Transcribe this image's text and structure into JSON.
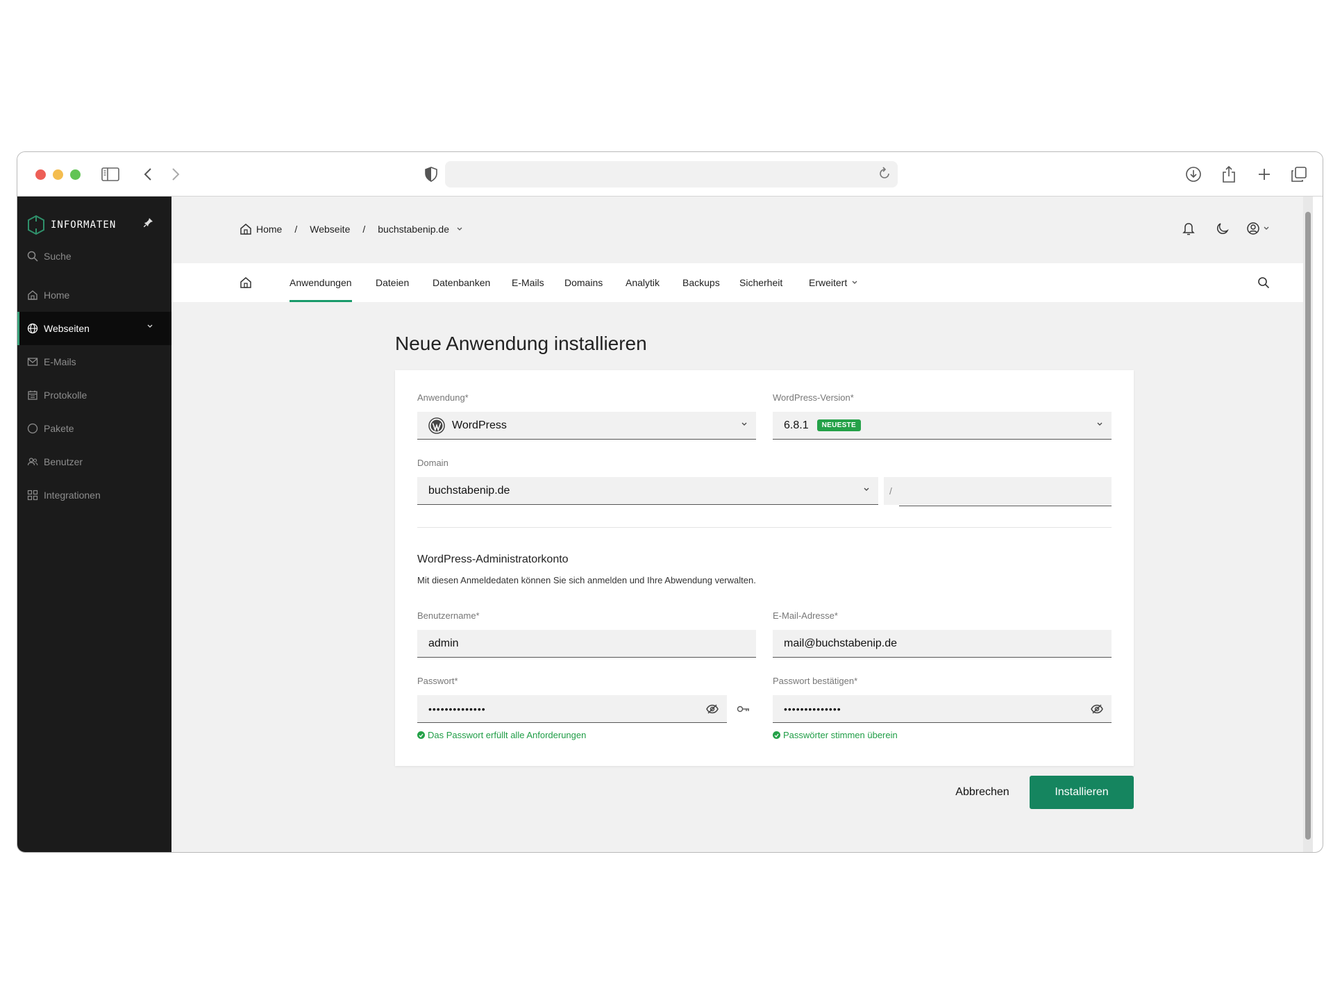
{
  "sidebar": {
    "brand": "INFORMATEN",
    "search_label": "Suche",
    "items": [
      {
        "label": "Home",
        "icon": "home-icon"
      },
      {
        "label": "Webseiten",
        "icon": "globe-icon",
        "active": true
      },
      {
        "label": "E-Mails",
        "icon": "mail-icon"
      },
      {
        "label": "Protokolle",
        "icon": "calendar-icon"
      },
      {
        "label": "Pakete",
        "icon": "circle-icon"
      },
      {
        "label": "Benutzer",
        "icon": "users-icon"
      },
      {
        "label": "Integrationen",
        "icon": "grid-icon"
      }
    ]
  },
  "breadcrumb": {
    "home": "Home",
    "sep": "/",
    "section": "Webseite",
    "site": "buchstabenip.de"
  },
  "tabs": [
    "Anwendungen",
    "Dateien",
    "Datenbanken",
    "E-Mails",
    "Domains",
    "Analytik",
    "Backups",
    "Sicherheit",
    "Erweitert"
  ],
  "active_tab": "Anwendungen",
  "page_title": "Neue Anwendung installieren",
  "form": {
    "app_label": "Anwendung*",
    "app_value": "WordPress",
    "version_label": "WordPress-Version*",
    "version_value": "6.8.1",
    "version_badge": "NEUESTE",
    "domain_label": "Domain",
    "domain_value": "buchstabenip.de",
    "path_prefix": "/",
    "path_value": "",
    "section_title": "WordPress-Administratorkonto",
    "section_desc": "Mit diesen Anmeldedaten können Sie sich anmelden und Ihre Abwendung verwalten.",
    "username_label": "Benutzername*",
    "username_value": "admin",
    "email_label": "E-Mail-Adresse*",
    "email_value": "mail@buchstabenip.de",
    "password_label": "Passwort*",
    "password_value": "••••••••••••••",
    "confirm_label": "Passwort bestätigen*",
    "confirm_value": "••••••••••••••",
    "password_ok": "Das Passwort erfüllt alle Anforderungen",
    "confirm_ok": "Passwörter stimmen überein"
  },
  "buttons": {
    "cancel": "Abbrechen",
    "install": "Installieren"
  },
  "colors": {
    "accent": "#15855f",
    "tab_underline": "#199b6b",
    "success": "#24a148",
    "sidebar_bg": "#1b1b1b"
  }
}
